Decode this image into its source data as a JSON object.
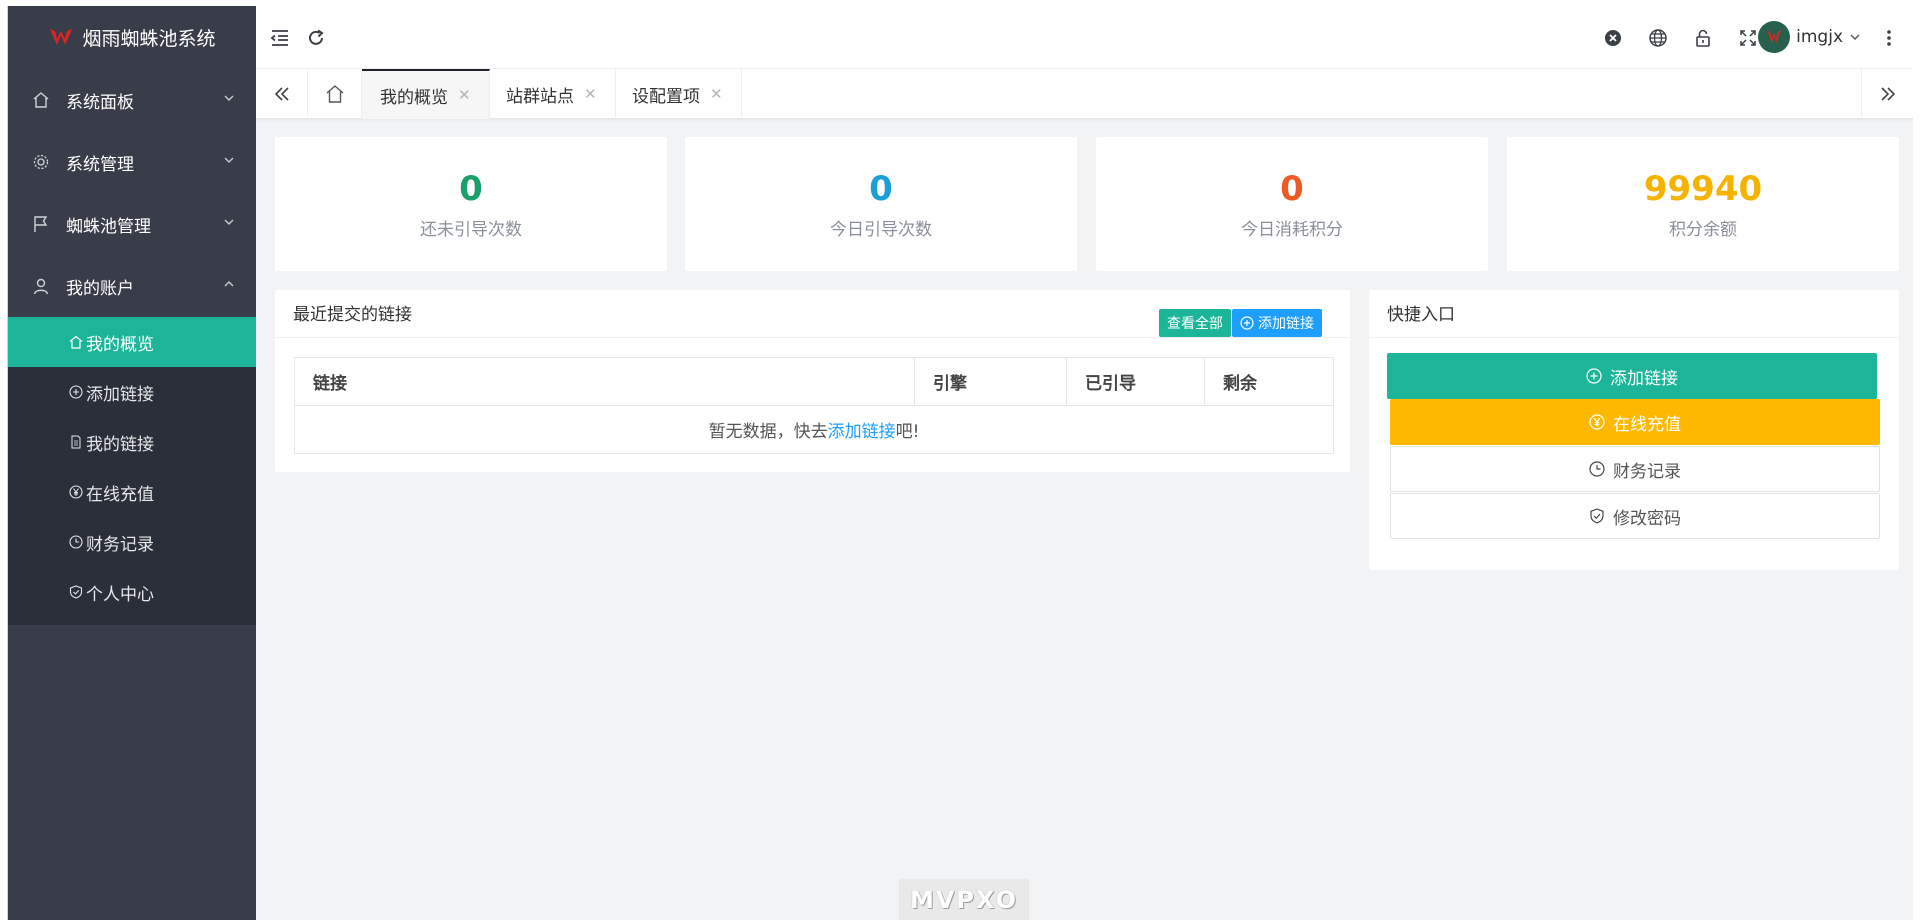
{
  "app": {
    "name": "烟雨蜘蛛池系统",
    "brand_color": "#e02424"
  },
  "sidebar": {
    "menus": [
      {
        "label": "系统面板",
        "icon": "home-icon",
        "expanded": false
      },
      {
        "label": "系统管理",
        "icon": "gear-icon",
        "expanded": false
      },
      {
        "label": "蜘蛛池管理",
        "icon": "flag-icon",
        "expanded": false
      },
      {
        "label": "我的账户",
        "icon": "user-icon",
        "expanded": true
      }
    ],
    "submenu": [
      {
        "label": "我的概览",
        "icon": "home-icon",
        "active": true
      },
      {
        "label": "添加链接",
        "icon": "plus-circle-icon"
      },
      {
        "label": "我的链接",
        "icon": "document-icon"
      },
      {
        "label": "在线充值",
        "icon": "yen-circle-icon"
      },
      {
        "label": "财务记录",
        "icon": "clock-icon"
      },
      {
        "label": "个人中心",
        "icon": "shield-check-icon"
      }
    ],
    "active_color": "#1cb59a"
  },
  "header": {
    "username": "imgjx"
  },
  "tabs": [
    {
      "label": "我的概览",
      "active": true
    },
    {
      "label": "站群站点",
      "active": false
    },
    {
      "label": "设配置项",
      "active": false
    }
  ],
  "stats": [
    {
      "value": "0",
      "label": "还未引导次数",
      "color": "#1aa06c"
    },
    {
      "value": "0",
      "label": "今日引导次数",
      "color": "#1a9fd6"
    },
    {
      "value": "0",
      "label": "今日消耗积分",
      "color": "#ee5a24"
    },
    {
      "value": "99940",
      "label": "积分余额",
      "color": "#f5b300"
    }
  ],
  "recent_links": {
    "title": "最近提交的链接",
    "view_all_label": "查看全部",
    "add_link_label": "添加链接",
    "columns": [
      "链接",
      "引擎",
      "已引导",
      "剩余"
    ],
    "empty": {
      "prefix": "暂无数据，快去",
      "link_text": "添加链接",
      "suffix": "吧!"
    }
  },
  "quick_entry": {
    "title": "快捷入口",
    "buttons": [
      {
        "label": "添加链接",
        "icon": "plus-circle-icon"
      },
      {
        "label": "在线充值",
        "icon": "yen-circle-icon"
      },
      {
        "label": "财务记录",
        "icon": "clock-icon"
      },
      {
        "label": "修改密码",
        "icon": "shield-check-icon"
      }
    ]
  },
  "watermark": "MVPXO"
}
